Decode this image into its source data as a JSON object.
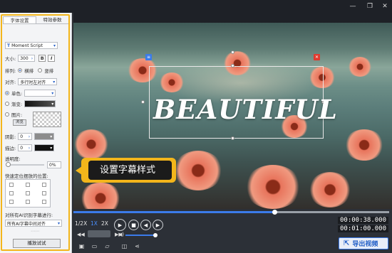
{
  "window": {
    "minimize": "—",
    "restore": "❐",
    "close": "✕"
  },
  "left_panel": {
    "tabs": [
      "字体设置",
      "特效参数"
    ],
    "font_name": "Moment Script",
    "size_label": "大小:",
    "size_value": "300",
    "bold": "B",
    "italic": "I",
    "layout_label": "排列:",
    "layout_options": [
      "横排",
      "竖排"
    ],
    "align_label": "对齐:",
    "align_value": "多行时左对齐",
    "fill_options": [
      "单色:",
      "渐变:",
      "图片:"
    ],
    "browse_label": "浏览",
    "shadow_label": "阴影:",
    "shadow_value": "0",
    "stroke_label": "描边:",
    "stroke_value": "0",
    "opacity_label": "透明度:",
    "opacity_value": "0%",
    "quick_pos_label": "快速定位摆放的位置:",
    "ai_label": "对所有AI识别字幕进行:",
    "ai_value": "所有AI字幕中间对齐",
    "preview_label": "播放试试"
  },
  "video": {
    "caption_text": "BEAUTIFUL",
    "callout_text": "设置字幕样式"
  },
  "player": {
    "speeds": [
      "1/2X",
      "1X",
      "2X"
    ],
    "active_speed": "1X",
    "current_time": "00:00:38.000",
    "total_time": "00:01:00.000",
    "export_label": "导出视频",
    "progress": 0.64,
    "volume": 0.9
  },
  "colors": {
    "accent": "#3b7bea",
    "highlight": "#f3b61b",
    "panel_bg": "#f3f4f6",
    "player_bg": "#2c3037"
  }
}
